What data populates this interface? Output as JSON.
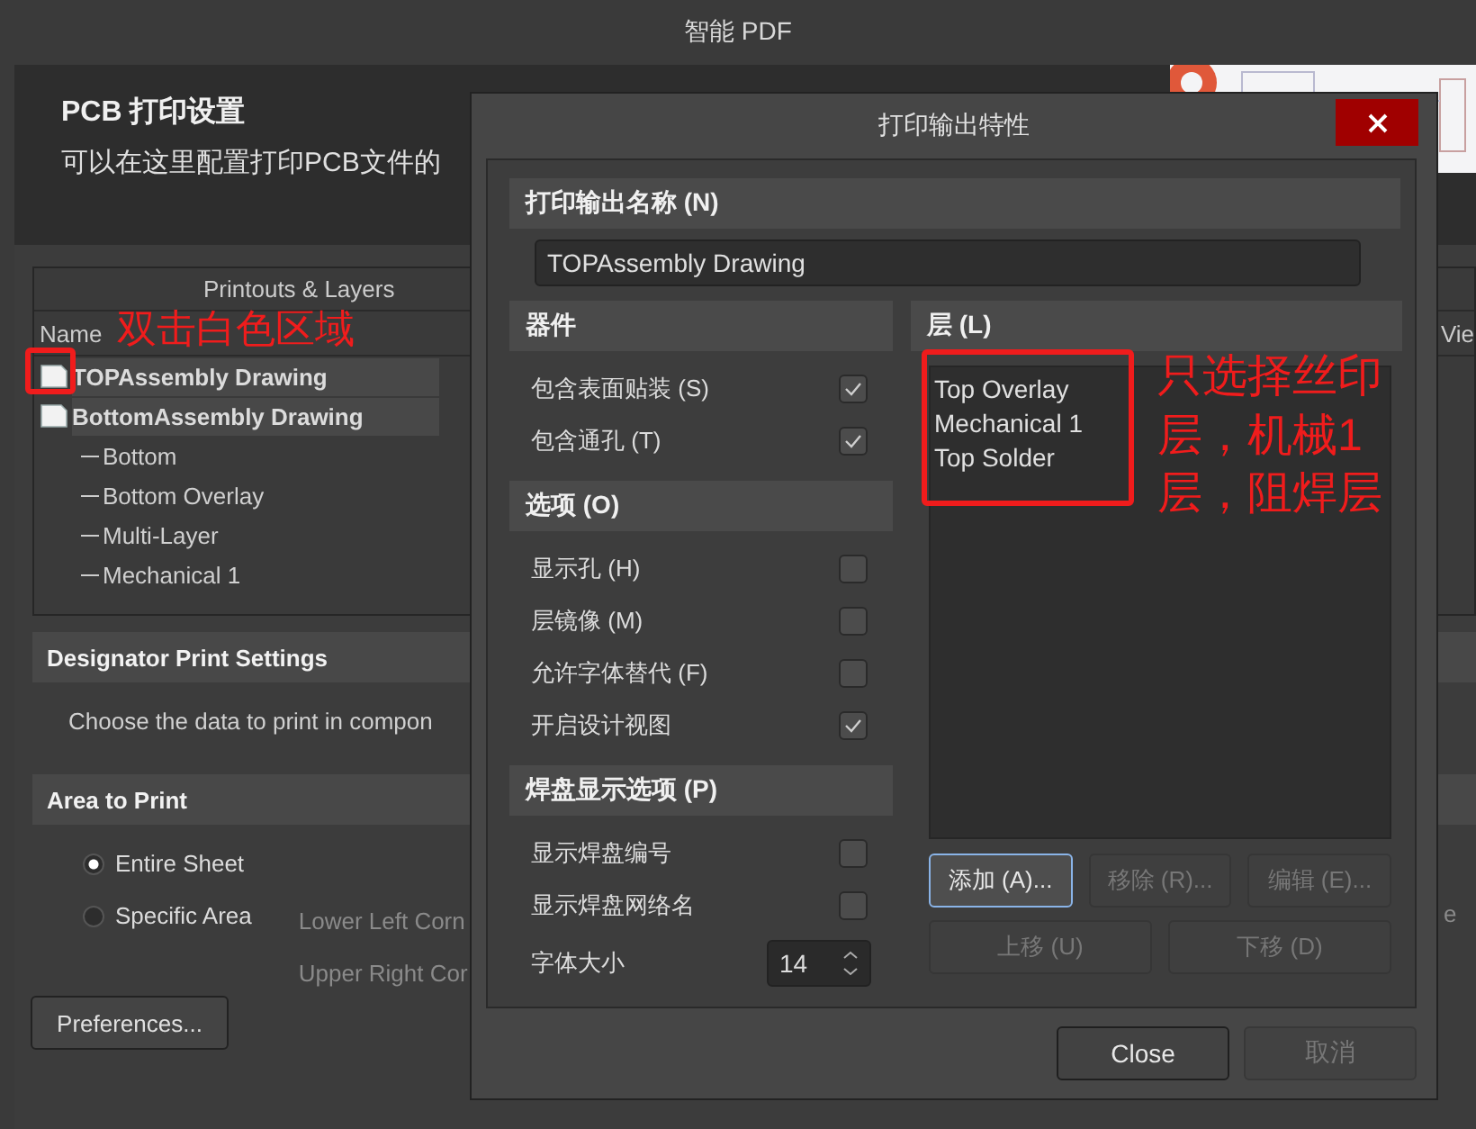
{
  "window": {
    "title": "智能 PDF"
  },
  "header": {
    "title": "PCB 打印设置",
    "subtitle": "可以在这里配置打印PCB文件的"
  },
  "printouts_table": {
    "title": "Printouts & Layers",
    "columns": [
      "Name",
      "Vie"
    ],
    "rows": [
      {
        "name": "TOPAssembly Drawing",
        "selected": true,
        "children": []
      },
      {
        "name": "BottomAssembly Drawing",
        "selected": true,
        "children": [
          {
            "name": "Bottom"
          },
          {
            "name": "Bottom Overlay"
          },
          {
            "name": "Multi-Layer"
          },
          {
            "name": "Mechanical 1"
          }
        ]
      }
    ]
  },
  "designator_section": {
    "title": "Designator Print Settings",
    "text": "Choose the data to print in compon"
  },
  "area_section": {
    "title": "Area to Print",
    "options": [
      {
        "label": "Entire Sheet",
        "selected": true
      },
      {
        "label": "Specific Area",
        "selected": false
      }
    ],
    "fields": [
      "Lower Left Corn",
      "Upper Right Cor"
    ],
    "edge_text": "e"
  },
  "preferences_button": "Preferences...",
  "dialog": {
    "title": "打印输出特性",
    "name_section": {
      "title": "打印输出名称 (N)",
      "value": "TOPAssembly Drawing"
    },
    "groups": [
      {
        "title": "器件",
        "items": [
          {
            "kind": "checkbox",
            "label": "包含表面贴装 (S)",
            "checked": true
          },
          {
            "kind": "checkbox",
            "label": "包含通孔 (T)",
            "checked": true
          }
        ]
      },
      {
        "title": "选项 (O)",
        "items": [
          {
            "kind": "checkbox",
            "label": "显示孔 (H)",
            "checked": false
          },
          {
            "kind": "checkbox",
            "label": "层镜像 (M)",
            "checked": false
          },
          {
            "kind": "checkbox",
            "label": "允许字体替代 (F)",
            "checked": false
          },
          {
            "kind": "checkbox",
            "label": "开启设计视图",
            "checked": true
          }
        ]
      },
      {
        "title": "焊盘显示选项 (P)",
        "items": [
          {
            "kind": "checkbox",
            "label": "显示焊盘编号",
            "checked": false
          },
          {
            "kind": "checkbox",
            "label": "显示焊盘网络名",
            "checked": false
          },
          {
            "kind": "spinner",
            "label": "字体大小",
            "value": "14"
          }
        ]
      }
    ],
    "layers": {
      "title": "层 (L)",
      "items": [
        "Top Overlay",
        "Mechanical 1",
        "Top Solder"
      ]
    },
    "layer_button_rows": [
      [
        {
          "label": "添加 (A)...",
          "disabled": false,
          "focused": true
        },
        {
          "label": "移除 (R)...",
          "disabled": true,
          "focused": false
        },
        {
          "label": "编辑 (E)...",
          "disabled": true,
          "focused": false
        }
      ],
      [
        {
          "label": "上移 (U)",
          "disabled": true,
          "focused": false
        },
        {
          "label": "下移 (D)",
          "disabled": true,
          "focused": false
        }
      ]
    ],
    "footer_buttons": [
      {
        "label": "Close",
        "disabled": false
      },
      {
        "label": "取消",
        "disabled": true
      }
    ]
  },
  "annotations": [
    {
      "kind": "text",
      "text": "双击白色区域"
    },
    {
      "kind": "box"
    },
    {
      "kind": "box"
    },
    {
      "kind": "text",
      "text": "只选择丝印层，机械1层，阻焊层"
    }
  ]
}
